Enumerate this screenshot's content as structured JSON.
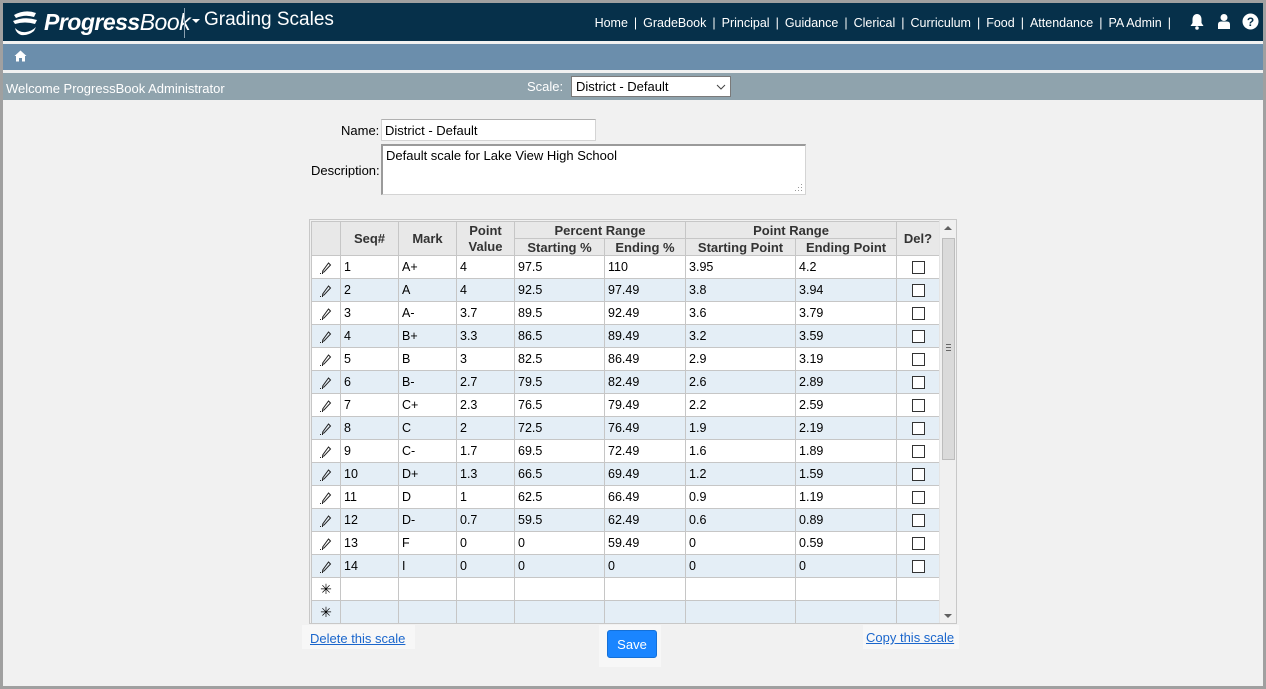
{
  "header": {
    "logo_text_bold": "Progress",
    "logo_text_regular": "Book",
    "app_title": "Grading Scales",
    "nav": [
      "Home",
      "GradeBook",
      "Principal",
      "Guidance",
      "Clerical",
      "Curriculum",
      "Food",
      "Attendance",
      "PA Admin"
    ],
    "icons": [
      "bell-icon",
      "user-icon",
      "help-icon"
    ]
  },
  "breadcrumb": {
    "icon": "home-icon"
  },
  "welcome_bar": {
    "welcome_text": "Welcome ProgressBook Administrator",
    "scale_label": "Scale:",
    "scale_selected": "District - Default"
  },
  "form": {
    "name_label": "Name:",
    "name_value": "District - Default",
    "description_label": "Description:",
    "description_value": "Default scale for Lake View High School"
  },
  "grid": {
    "headers": {
      "seq": "Seq#",
      "mark": "Mark",
      "point_value": "Point Value",
      "percent_range": "Percent Range",
      "starting_pct": "Starting %",
      "ending_pct": "Ending %",
      "point_range": "Point Range",
      "starting_point": "Starting Point",
      "ending_point": "Ending Point",
      "del": "Del?"
    },
    "rows": [
      {
        "seq": "1",
        "mark": "A+",
        "point_value": "4",
        "start_pct": "97.5",
        "end_pct": "110",
        "start_pt": "3.95",
        "end_pt": "4.2",
        "del": false
      },
      {
        "seq": "2",
        "mark": "A",
        "point_value": "4",
        "start_pct": "92.5",
        "end_pct": "97.49",
        "start_pt": "3.8",
        "end_pt": "3.94",
        "del": false
      },
      {
        "seq": "3",
        "mark": "A-",
        "point_value": "3.7",
        "start_pct": "89.5",
        "end_pct": "92.49",
        "start_pt": "3.6",
        "end_pt": "3.79",
        "del": false
      },
      {
        "seq": "4",
        "mark": "B+",
        "point_value": "3.3",
        "start_pct": "86.5",
        "end_pct": "89.49",
        "start_pt": "3.2",
        "end_pt": "3.59",
        "del": false
      },
      {
        "seq": "5",
        "mark": "B",
        "point_value": "3",
        "start_pct": "82.5",
        "end_pct": "86.49",
        "start_pt": "2.9",
        "end_pt": "3.19",
        "del": false
      },
      {
        "seq": "6",
        "mark": "B-",
        "point_value": "2.7",
        "start_pct": "79.5",
        "end_pct": "82.49",
        "start_pt": "2.6",
        "end_pt": "2.89",
        "del": false
      },
      {
        "seq": "7",
        "mark": "C+",
        "point_value": "2.3",
        "start_pct": "76.5",
        "end_pct": "79.49",
        "start_pt": "2.2",
        "end_pt": "2.59",
        "del": false
      },
      {
        "seq": "8",
        "mark": "C",
        "point_value": "2",
        "start_pct": "72.5",
        "end_pct": "76.49",
        "start_pt": "1.9",
        "end_pt": "2.19",
        "del": false
      },
      {
        "seq": "9",
        "mark": "C-",
        "point_value": "1.7",
        "start_pct": "69.5",
        "end_pct": "72.49",
        "start_pt": "1.6",
        "end_pt": "1.89",
        "del": false
      },
      {
        "seq": "10",
        "mark": "D+",
        "point_value": "1.3",
        "start_pct": "66.5",
        "end_pct": "69.49",
        "start_pt": "1.2",
        "end_pt": "1.59",
        "del": false
      },
      {
        "seq": "11",
        "mark": "D",
        "point_value": "1",
        "start_pct": "62.5",
        "end_pct": "66.49",
        "start_pt": "0.9",
        "end_pt": "1.19",
        "del": false
      },
      {
        "seq": "12",
        "mark": "D-",
        "point_value": "0.7",
        "start_pct": "59.5",
        "end_pct": "62.49",
        "start_pt": "0.6",
        "end_pt": "0.89",
        "del": false
      },
      {
        "seq": "13",
        "mark": "F",
        "point_value": "0",
        "start_pct": "0",
        "end_pct": "59.49",
        "start_pt": "0",
        "end_pt": "0.59",
        "del": false
      },
      {
        "seq": "14",
        "mark": "I",
        "point_value": "0",
        "start_pct": "0",
        "end_pct": "0",
        "start_pt": "0",
        "end_pt": "0",
        "del": false
      }
    ],
    "new_rows": 2,
    "edit_icon": "pencil-icon",
    "new_row_icon": "asterisk-icon"
  },
  "actions": {
    "delete_link": "Delete this scale",
    "save_label": "Save",
    "copy_link": "Copy this scale"
  },
  "colors": {
    "header_bg": "#06304a",
    "crumb_bg": "#6b8eac",
    "welcome_bg": "#8fa3ad",
    "row_alt": "#e4eef6",
    "save_btn": "#1a85ff",
    "link": "#1a66cc"
  }
}
